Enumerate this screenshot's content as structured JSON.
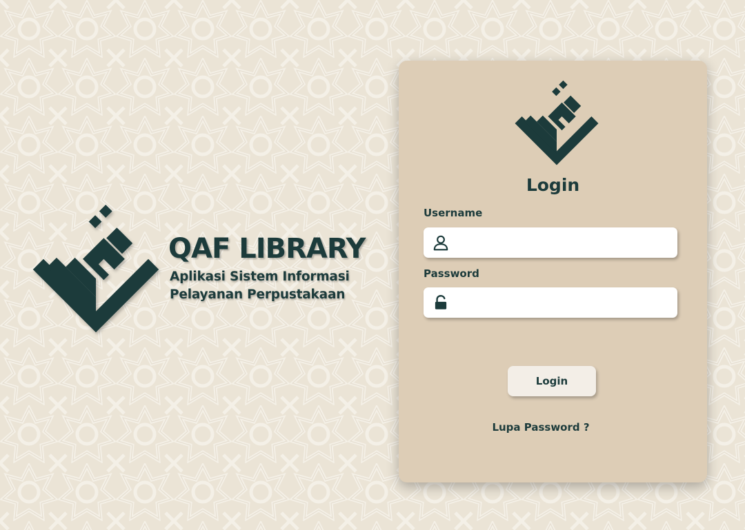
{
  "brand": {
    "title": "QAF LIBRARY",
    "subtitle_line1": "Aplikasi Sistem Informasi",
    "subtitle_line2": "Pelayanan Perpustakaan"
  },
  "login_card": {
    "title": "Login",
    "username_label": "Username",
    "username_value": "",
    "password_label": "Password",
    "password_value": "",
    "submit_label": "Login",
    "forgot_label": "Lupa Password ?"
  },
  "colors": {
    "primary": "#1c3b3b",
    "card_background": "#ddcdb6",
    "page_background": "#ebe4d6"
  },
  "icons": {
    "username": "user-icon",
    "password": "lock-icon"
  }
}
